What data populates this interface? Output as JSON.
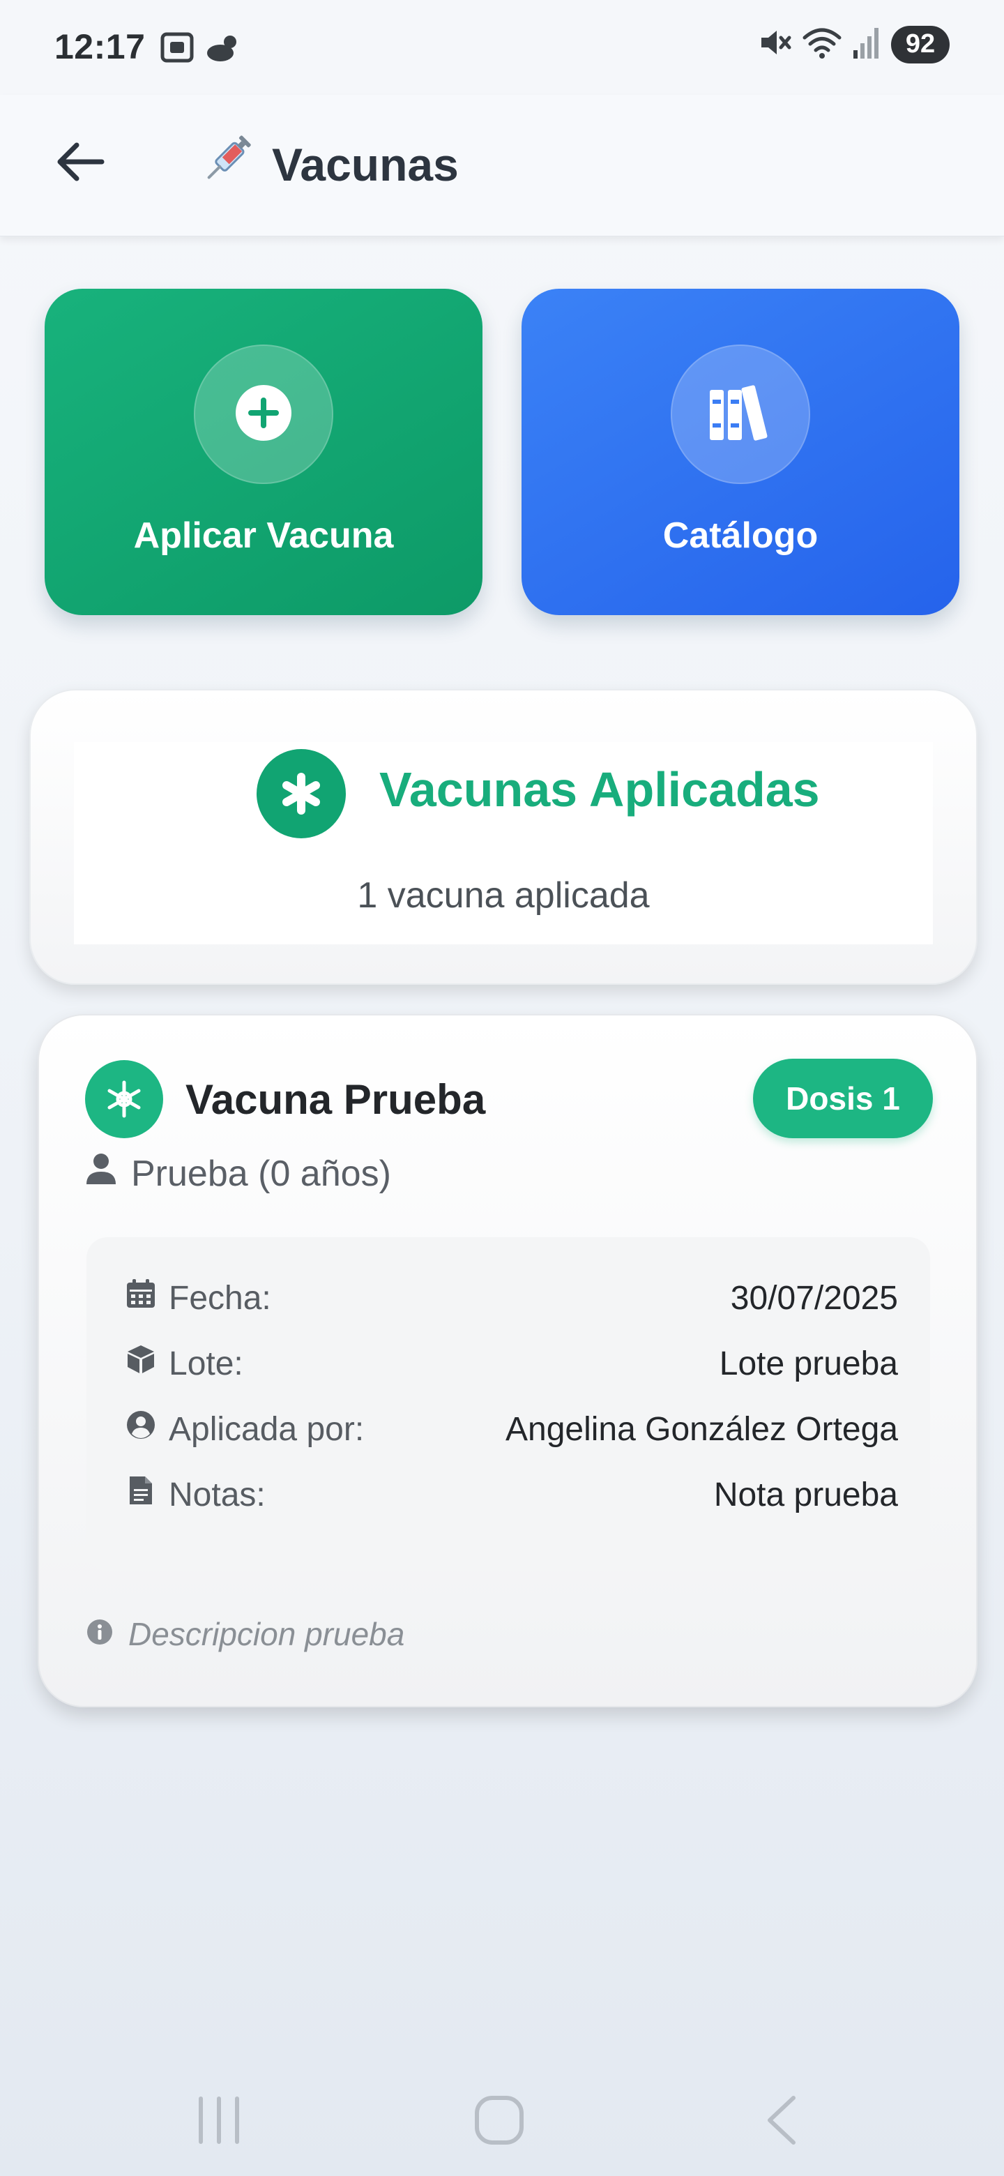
{
  "status_bar": {
    "time": "12:17",
    "battery": "92",
    "icons_left": [
      "screenshot-icon",
      "weather-icon"
    ],
    "icons_right": [
      "mute-icon",
      "wifi-icon",
      "signal-icon",
      "battery-icon"
    ]
  },
  "app_bar": {
    "title": "Vacunas",
    "title_icon": "syringe-icon",
    "back_icon": "arrow-left-icon"
  },
  "actions": [
    {
      "label": "Aplicar Vacuna",
      "icon": "plus-circle-icon",
      "color": "#10a874"
    },
    {
      "label": "Catálogo",
      "icon": "books-icon",
      "color": "#2f6ff0"
    }
  ],
  "summary": {
    "title": "Vacunas Aplicadas",
    "count_text": "1 vacuna aplicada",
    "icon": "asterisk-icon",
    "accent": "#18ad7c"
  },
  "vaccine": {
    "name": "Vacuna Prueba",
    "icon": "star-of-life-icon",
    "dose": "Dosis 1",
    "patient": "Prueba (0 años)",
    "details": [
      {
        "key": "Fecha:",
        "value": "30/07/2025",
        "icon": "calendar-icon"
      },
      {
        "key": "Lote:",
        "value": "Lote prueba",
        "icon": "box-icon"
      },
      {
        "key": "Aplicada por:",
        "value": "Angelina González Ortega",
        "icon": "user-circle-icon"
      },
      {
        "key": "Notas:",
        "value": "Nota prueba",
        "icon": "file-icon"
      }
    ],
    "description": "Descripcion prueba",
    "accent": "#1db683"
  },
  "nav": [
    "recent-apps-icon",
    "home-icon",
    "back-icon"
  ]
}
